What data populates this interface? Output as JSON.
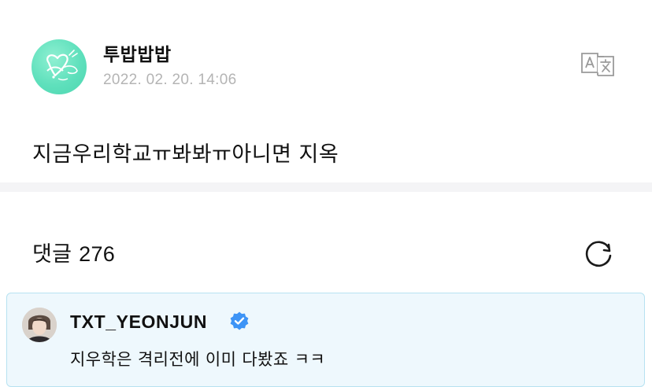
{
  "post": {
    "author": "투밥밥밥",
    "timestamp": "2022. 02. 20. 14:06",
    "body": "지금우리학교ㅠ봐봐ㅠ아니면 지옥",
    "avatar_icon": "heart-doodle-avatar",
    "translate_icon": "translate-icon"
  },
  "comments": {
    "label": "댓글",
    "count": "276",
    "refresh_icon": "refresh-icon",
    "items": [
      {
        "author": "TXT_YEONJUN",
        "verified": true,
        "text": "지우학은 격리전에 이미 다봤죠 ㅋㅋ",
        "highlight_bg": "#eef8fd",
        "highlight_border": "#b7e2f1"
      }
    ]
  },
  "colors": {
    "avatar_mint": "#5fe0bc",
    "timestamp_gray": "#b4b4b4",
    "verified_blue": "#3d94f6",
    "divider": "#f4f4f6"
  }
}
